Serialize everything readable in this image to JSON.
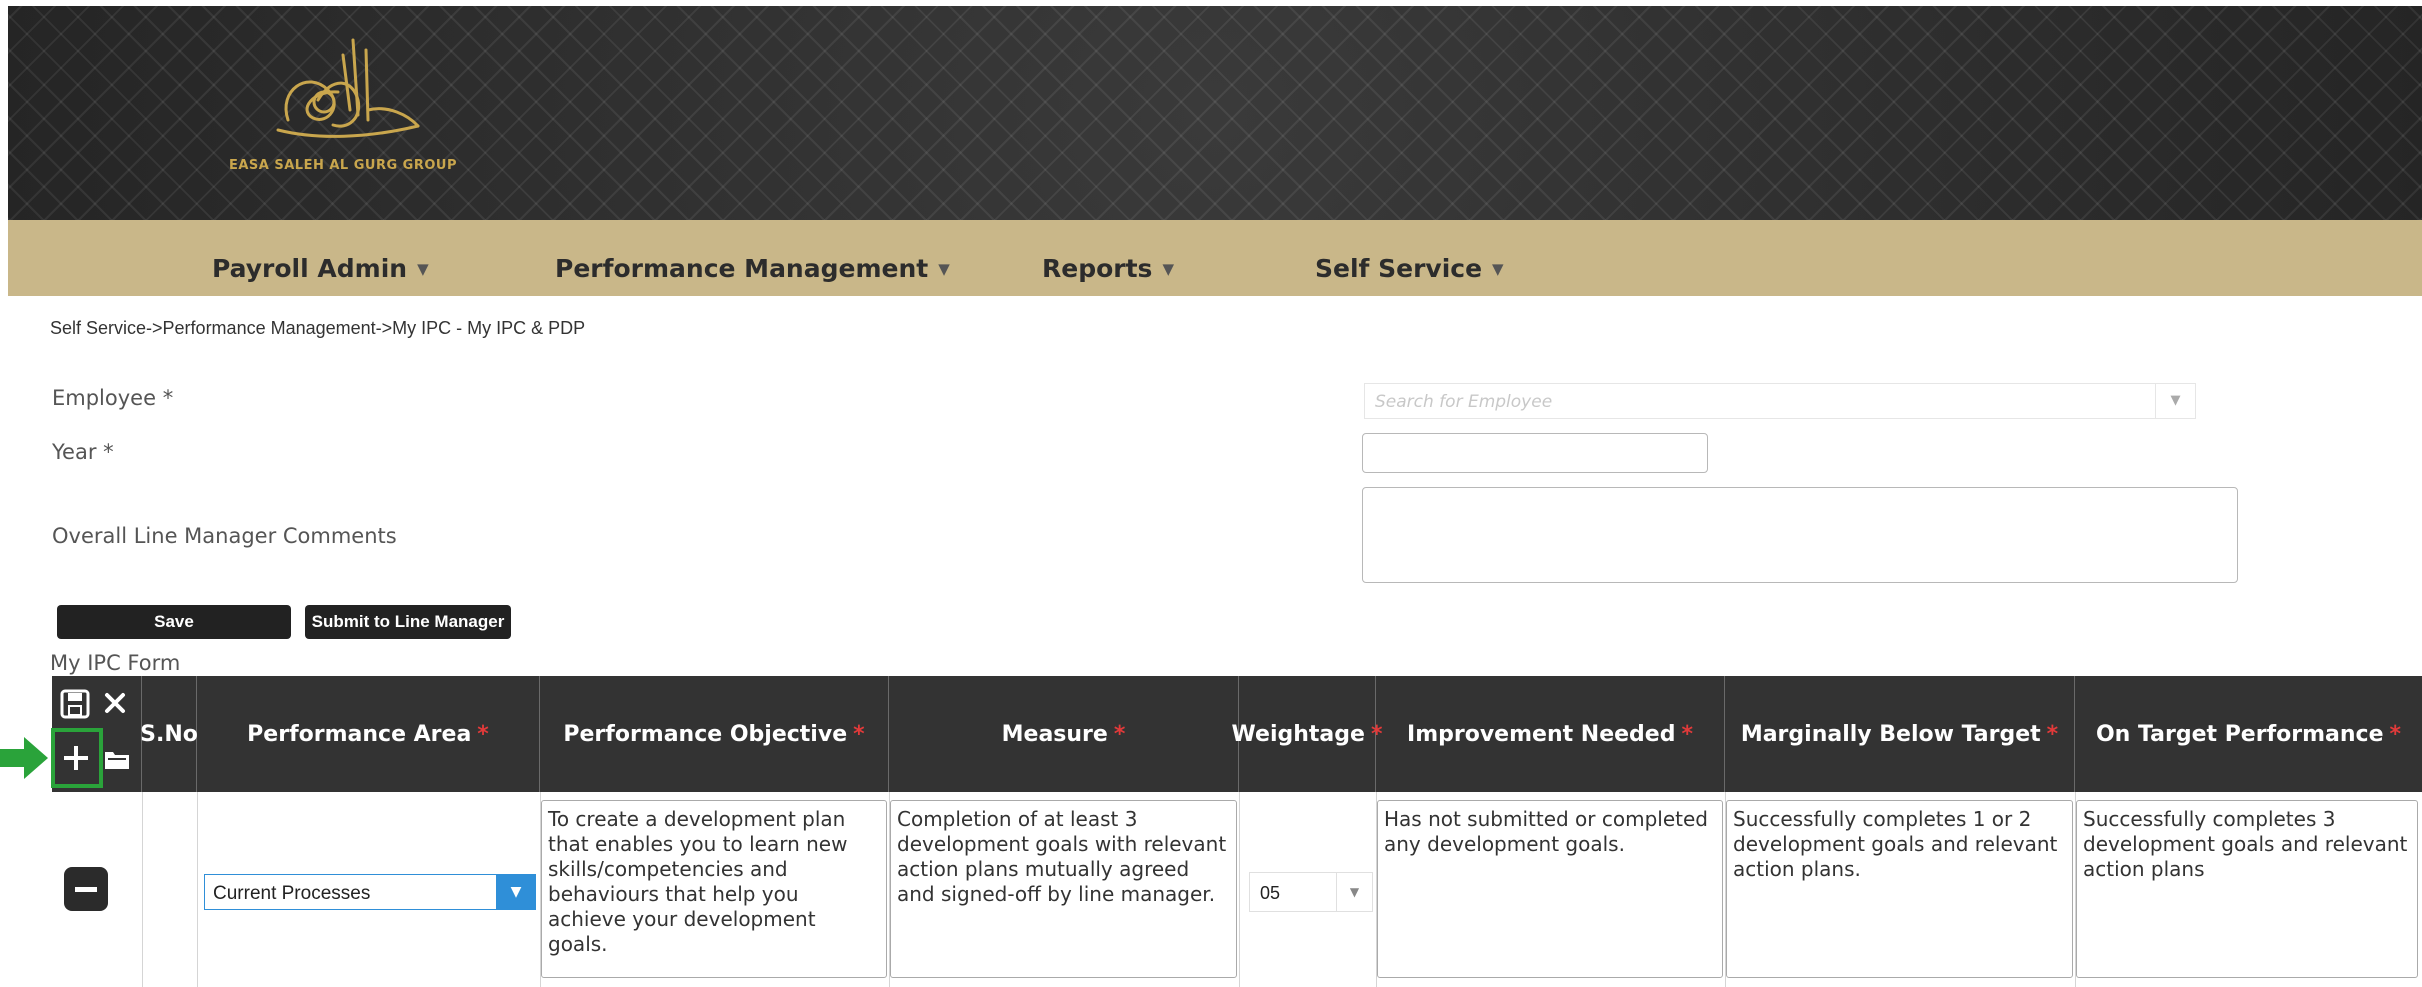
{
  "brand": {
    "name": "EASA SALEH AL GURG GROUP"
  },
  "nav": {
    "items": [
      {
        "label": "Payroll Admin"
      },
      {
        "label": "Performance Management"
      },
      {
        "label": "Reports"
      },
      {
        "label": "Self Service"
      }
    ],
    "caret": "▼"
  },
  "breadcrumb": "Self Service->Performance Management->My IPC - My IPC & PDP",
  "form": {
    "employee_label": "Employee",
    "year_label": "Year",
    "required_mark": "*",
    "comments_label": "Overall Line Manager Comments",
    "employee_placeholder": "Search for Employee",
    "year_value": "",
    "comments_value": ""
  },
  "buttons": {
    "save": "Save",
    "submit": "Submit to Line Manager"
  },
  "grid": {
    "title": "My IPC Form",
    "required_star": "*",
    "columns": [
      {
        "label": "S.No",
        "required": false
      },
      {
        "label": "Performance Area",
        "required": true
      },
      {
        "label": "Performance Objective",
        "required": true
      },
      {
        "label": "Measure",
        "required": true
      },
      {
        "label": "Weightage",
        "required": true
      },
      {
        "label": "Improvement Needed",
        "required": true
      },
      {
        "label": "Marginally Below Target",
        "required": true
      },
      {
        "label": "On Target Performance",
        "required": true
      }
    ],
    "header_icons": [
      "save-icon",
      "close-icon",
      "add-icon",
      "folder-icon"
    ],
    "rows": [
      {
        "sno": "",
        "performance_area": "Current Processes",
        "performance_objective": "To create a development plan that enables you to learn new skills/competencies and behaviours that help you achieve your development goals.",
        "measure": "Completion of at least 3 development goals with relevant action plans mutually agreed and signed-off by line manager.",
        "weightage": "05",
        "improvement_needed": "Has not submitted or completed any development goals.",
        "marginally_below_target": "Successfully completes 1 or 2 development goals and relevant action plans.",
        "on_target_performance": "Successfully completes 3 development goals and relevant action plans"
      }
    ]
  },
  "colors": {
    "accent_green": "#2aa33a",
    "nav_bg": "#c9b789",
    "header_bg": "#333333",
    "dropdown_blue": "#2f8fd8"
  }
}
